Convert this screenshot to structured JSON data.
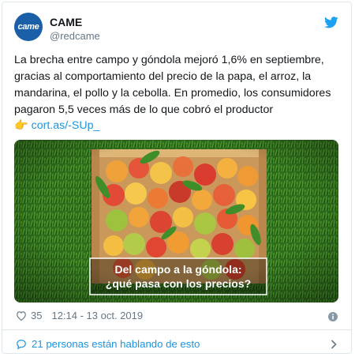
{
  "account": {
    "name": "CAME",
    "handle": "@redcame",
    "avatar_text": "came"
  },
  "tweet": {
    "text": "La brecha entre campo y góndola mejoró 1,6% en septiembre, gracias al comportamiento del precio de la papa, el arroz, la mandarina, el pollo y la cebolla. En promedio, los consumidores pagaron 5,5 veces más de lo que cobró el productor",
    "pointing_emoji": "👉",
    "link": "cort.as/-SUp_"
  },
  "media": {
    "caption_line1": "Del campo a la góndola:",
    "caption_line2": "¿qué pasa con los precios?"
  },
  "footer": {
    "likes": "35",
    "timestamp": "12:14 - 13 oct. 2019",
    "conversation": "21 personas están hablando de esto"
  },
  "colors": {
    "brand_blue": "#1b95e0",
    "avatar_blue": "#1b5fa8",
    "muted": "#657786"
  }
}
